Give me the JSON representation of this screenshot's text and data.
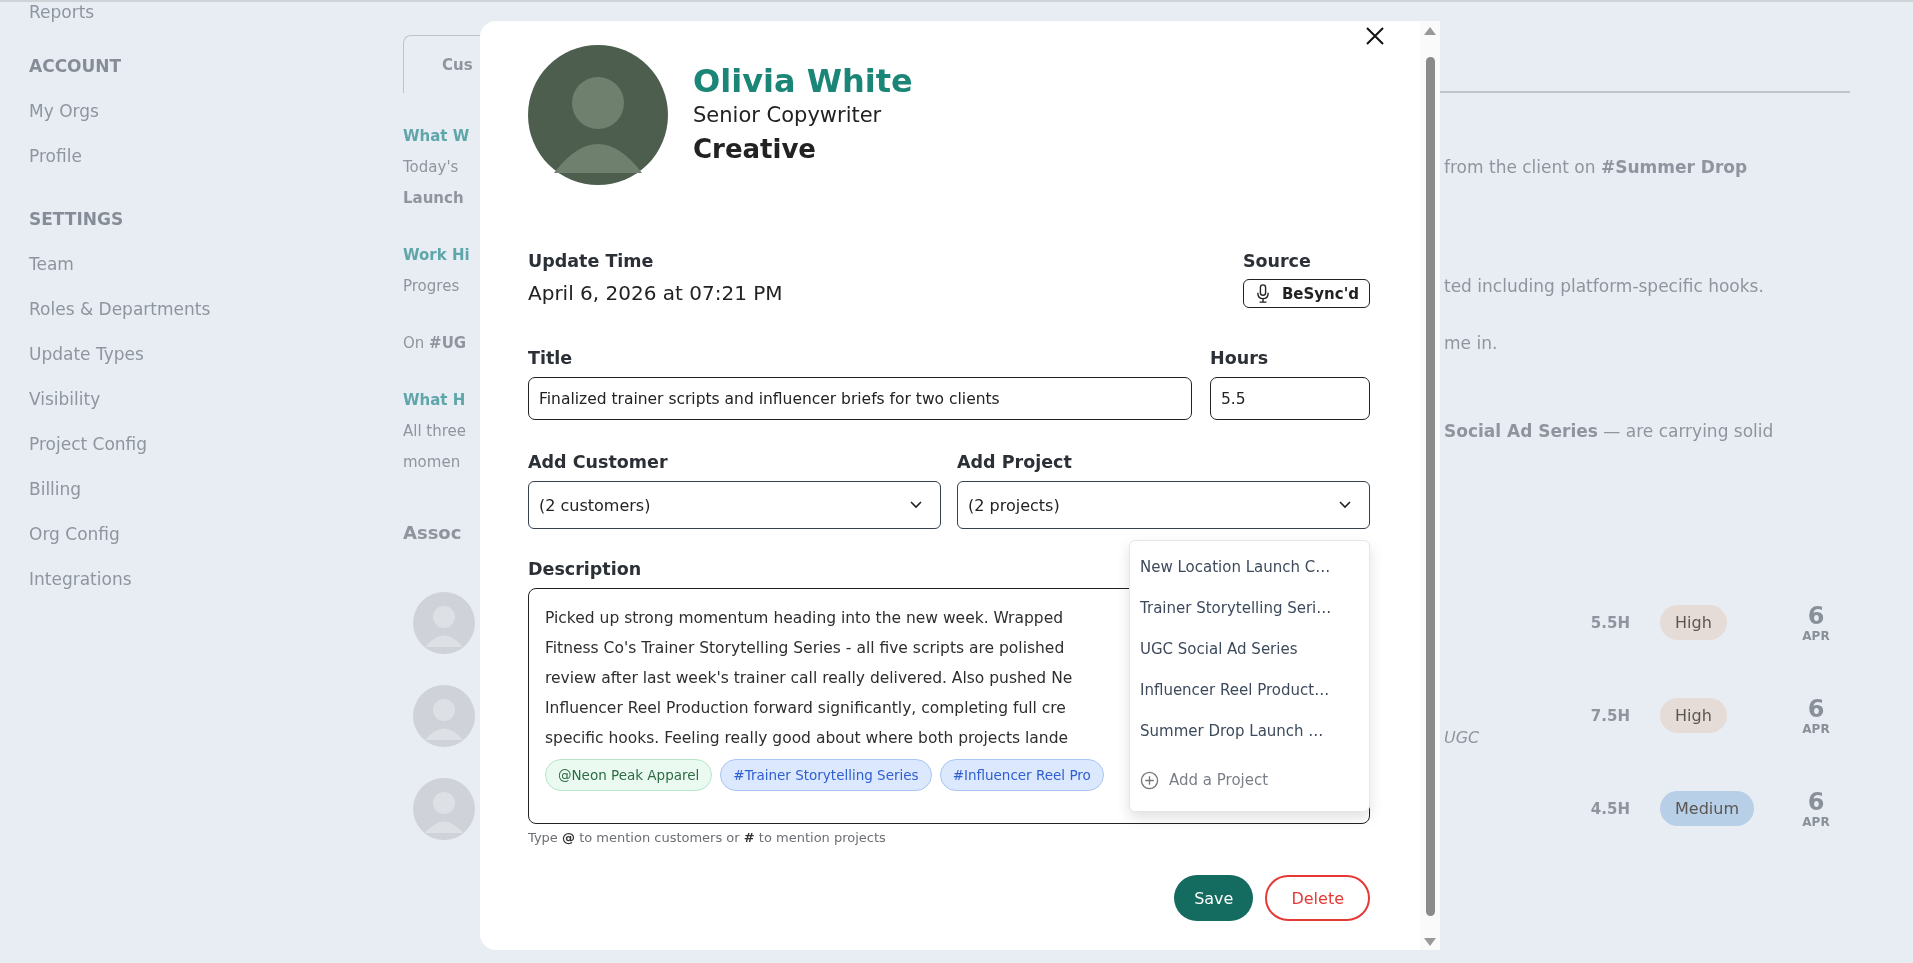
{
  "sidebar": {
    "items": [
      {
        "kind": "link",
        "label": "Reports"
      },
      {
        "kind": "heading",
        "label": "ACCOUNT"
      },
      {
        "kind": "link",
        "label": "My Orgs"
      },
      {
        "kind": "link",
        "label": "Profile"
      },
      {
        "kind": "heading",
        "label": "SETTINGS"
      },
      {
        "kind": "link",
        "label": "Team"
      },
      {
        "kind": "link",
        "label": "Roles & Departments"
      },
      {
        "kind": "link",
        "label": "Update Types"
      },
      {
        "kind": "link",
        "label": "Visibility"
      },
      {
        "kind": "link",
        "label": "Project Config"
      },
      {
        "kind": "link",
        "label": "Billing"
      },
      {
        "kind": "link",
        "label": "Org Config"
      },
      {
        "kind": "link",
        "label": "Integrations"
      }
    ]
  },
  "content": {
    "tab": "Cus",
    "blocks": [
      [
        {
          "kind": "heading",
          "left": "What W"
        },
        {
          "kind": "text",
          "left": "Today's",
          "right": "from the client on **#Summer Drop**"
        },
        {
          "kind": "bold",
          "left": "Launch"
        }
      ],
      [
        {
          "kind": "heading",
          "left": "Work Hi"
        },
        {
          "kind": "text",
          "left": "Progres",
          "right": "ted including platform-specific hooks."
        }
      ],
      [
        {
          "kind": "text",
          "left": "On **#UG**",
          "right": "me in."
        }
      ],
      [
        {
          "kind": "heading",
          "left": "What H"
        },
        {
          "kind": "text",
          "left": "All three",
          "right": "**Social Ad Series** — are carrying solid"
        },
        {
          "kind": "text",
          "left": "momen"
        }
      ],
      [
        {
          "kind": "section",
          "left": "Assoc"
        }
      ]
    ],
    "entries": [
      {
        "hours": "5.5H",
        "priority": "High",
        "color": "#e6dcd7",
        "day": "6",
        "month": "APR"
      },
      {
        "project": "UGC",
        "hours": "7.5H",
        "priority": "High",
        "color": "#e6dcd7",
        "day": "6",
        "month": "APR"
      },
      {
        "hours": "4.5H",
        "priority": "Medium",
        "color": "#b7cfe7",
        "day": "6",
        "month": "APR"
      }
    ]
  },
  "dialog": {
    "name": "Olivia White",
    "role": "Senior Copywriter",
    "department": "Creative",
    "update_time": {
      "label": "Update Time",
      "value": "April 6, 2026 at 07:21 PM"
    },
    "source": {
      "label": "Source",
      "value": "BeSync'd"
    },
    "title": {
      "label": "Title",
      "value": "Finalized trainer scripts and influencer briefs for two clients"
    },
    "hours": {
      "label": "Hours",
      "value": "5.5"
    },
    "customer": {
      "label": "Add Customer",
      "value": "(2 customers)"
    },
    "project": {
      "label": "Add Project",
      "value": "(2 projects)",
      "expanded": true,
      "options": [
        "New Location Launch C…",
        "Trainer Storytelling Seri…",
        "UGC Social Ad Series",
        "Influencer Reel Product…",
        "Summer Drop Launch …"
      ],
      "add_label": "Add a Project"
    },
    "description": {
      "label": "Description",
      "lines": [
        "Picked up strong momentum heading into the new week. Wrapped",
        "Fitness Co's Trainer Storytelling Series - all five scripts are polished",
        "review after last week's trainer call really delivered. Also pushed Ne",
        "Influencer Reel Production forward significantly, completing full cre",
        "specific hooks. Feeling really good about where both projects lande"
      ],
      "tags": [
        {
          "kind": "customer",
          "text": "@Neon Peak Apparel"
        },
        {
          "kind": "project",
          "text": "#Trainer Storytelling Series"
        },
        {
          "kind": "project",
          "text": "#Influencer Reel Pro"
        }
      ]
    },
    "hint": "Type **@** to mention customers or **#** to mention projects",
    "buttons": [
      {
        "kind": "primary",
        "label": "Save"
      },
      {
        "kind": "danger",
        "label": "Delete"
      }
    ]
  }
}
